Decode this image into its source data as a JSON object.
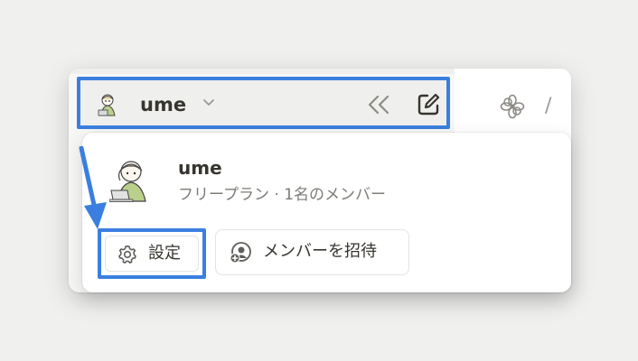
{
  "workspace": {
    "name": "ume",
    "avatar_icon": "user-avatar-illustration",
    "chevron_icon": "chevron-down-icon",
    "collapse_icon": "double-chevron-left-icon",
    "new_page_icon": "compose-icon"
  },
  "main": {
    "page_icon": "flower-icon",
    "breadcrumb_separator": "/"
  },
  "popup": {
    "name": "ume",
    "subtitle": "フリープラン · 1名のメンバー",
    "settings_label": "設定",
    "settings_icon": "gear-icon",
    "invite_label": "メンバーを招待",
    "invite_icon": "add-member-icon"
  },
  "annotation": {
    "highlight_color": "#3a7fe0"
  }
}
